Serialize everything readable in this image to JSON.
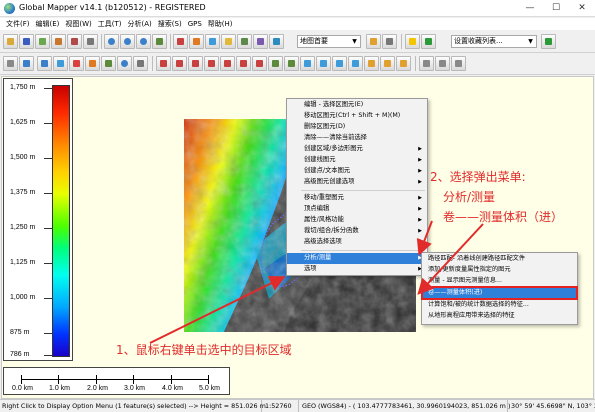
{
  "window": {
    "title": "Global Mapper v14.1 (b120512) - REGISTERED",
    "buttons": {
      "minimize": "—",
      "maximize": "☐",
      "close": "✕"
    }
  },
  "menubar": [
    "文件(F)",
    "编辑(E)",
    "视图(W)",
    "工具(T)",
    "分析(A)",
    "搜索(S)",
    "GPS",
    "帮助(H)"
  ],
  "toolbar": {
    "layer_combo": "地图首要",
    "bookmark_combo": "设置收藏列表..."
  },
  "legend": {
    "labels": [
      "1,750 m",
      "1,625 m",
      "1,500 m",
      "1,375 m",
      "1,250 m",
      "1,125 m",
      "1,000 m",
      "875 m",
      "786 m"
    ]
  },
  "scalebar": {
    "labels": [
      "0.0 km",
      "1.0 km",
      "2.0 km",
      "3.0 km",
      "4.0 km",
      "5.0 km"
    ]
  },
  "context_menu": {
    "items": [
      "编辑 - 选择区图元(E)",
      "移动区图元(Ctrl + Shift + M)(M)",
      "删除区图元(D)",
      "清除——清除当前选择",
      "创建区域/多边形图元",
      "创建线图元",
      "创建点/文本图元",
      "高级图元创建选项",
      "移动/重塑图元",
      "顶点编辑",
      "属性/风格功能",
      "裁切/组合/拆分函数",
      "高级选择选项",
      "分析/测量",
      "选项"
    ],
    "highlighted": "分析/测量"
  },
  "submenu": {
    "items": [
      "路径匹配- 沿着线创建路径匹配文件",
      "添加/更新度量属性指定的图元",
      "测量 - 显示图元测量信息...",
      "卷——测量体积(进)",
      "计算饱和/被的统计数据选择的特征...",
      "从地形高程应用带来选择的特征"
    ],
    "highlighted": "卷——测量体积(进)"
  },
  "annotations": {
    "step1": "1、鼠标右键单击选中的目标区域",
    "step2_line1": "2、选择弹出菜单:",
    "step2_line2": "分析/测量",
    "step2_line3": "卷——测量体积（进）"
  },
  "statusbar": {
    "hint": "Right Click to Display Option Menu (1 feature(s) selected) --> Height = 851.026 m",
    "scale": "1:52760",
    "coords": "GEO (WGS84) - ( 103.4777783461, 30.9960194023, 851.026 m )",
    "dms": "30° 59' 45.6698\" N, 103° 28'"
  },
  "colors": {
    "annotation": "#e12b2b",
    "highlight": "#2f80d8",
    "map_background": "#ffffe7"
  }
}
